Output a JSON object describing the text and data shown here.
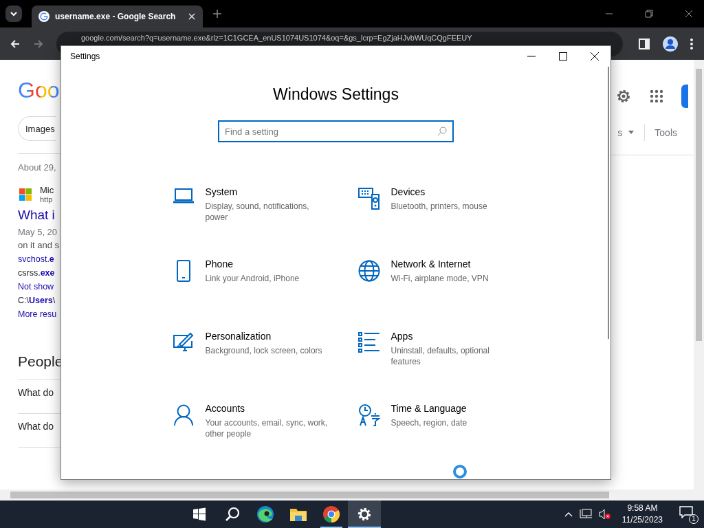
{
  "browser": {
    "tab_title": "username.exe - Google Search",
    "address": "google.com/search?q=username.exe&rlz=1C1GCEA_enUS1074US1074&oq=&gs_lcrp=EgZjaHJvbWUqCQgFEEUY",
    "page": {
      "logo": "Goo",
      "chips": [
        "Images"
      ],
      "filter": "s",
      "tools": "Tools",
      "result_stats": "About 29,",
      "result": {
        "site": "Mic",
        "url": "http",
        "title": "What i",
        "date": "May 5, 20",
        "snippet": "on it and s",
        "links": [
          "svchost.**e**",
          "csrss.**exe**",
          "Not show",
          "C:\\**Users**\\"
        ],
        "more": "More resu"
      },
      "people_heading": "People",
      "questions": [
        "What do",
        "What do"
      ]
    }
  },
  "settings": {
    "title": "Settings",
    "heading": "Windows Settings",
    "search": {
      "placeholder": "Find a setting"
    },
    "categories": [
      {
        "kind": "laptop",
        "name": "System",
        "description": "Display, sound, notifications, power"
      },
      {
        "kind": "devices",
        "name": "Devices",
        "description": "Bluetooth, printers, mouse"
      },
      {
        "kind": "phone",
        "name": "Phone",
        "description": "Link your Android, iPhone"
      },
      {
        "kind": "globe",
        "name": "Network & Internet",
        "description": "Wi-Fi, airplane mode, VPN"
      },
      {
        "kind": "brush",
        "name": "Personalization",
        "description": "Background, lock screen, colors"
      },
      {
        "kind": "list",
        "name": "Apps",
        "description": "Uninstall, defaults, optional features"
      },
      {
        "kind": "person",
        "name": "Accounts",
        "description": "Your accounts, email, sync, work, other people"
      },
      {
        "kind": "clock",
        "name": "Time & Language",
        "description": "Speech, region, date"
      }
    ]
  },
  "taskbar": {
    "apps": [
      {
        "kind": "start",
        "running": false,
        "selected": false
      },
      {
        "kind": "search",
        "running": false,
        "selected": false
      },
      {
        "kind": "edge",
        "running": false,
        "selected": false
      },
      {
        "kind": "folder",
        "running": false,
        "selected": false
      },
      {
        "kind": "chrome",
        "running": true,
        "selected": false
      },
      {
        "kind": "gear",
        "running": true,
        "selected": true
      }
    ],
    "time": "9:58 AM",
    "date": "11/25/2023",
    "notifications": "1"
  }
}
